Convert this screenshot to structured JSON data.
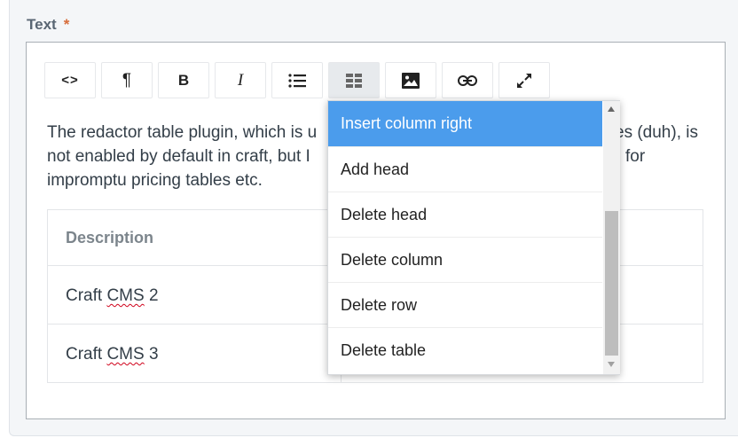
{
  "field": {
    "label": "Text",
    "required_marker": "*"
  },
  "toolbar": {
    "buttons": [
      {
        "name": "html-button",
        "icon": "code-icon",
        "glyph": "<>"
      },
      {
        "name": "format-button",
        "icon": "paragraph-icon",
        "glyph": "¶"
      },
      {
        "name": "bold-button",
        "icon": "bold-icon",
        "glyph": "B"
      },
      {
        "name": "italic-button",
        "icon": "italic-icon",
        "glyph": "I"
      },
      {
        "name": "lists-button",
        "icon": "list-icon"
      },
      {
        "name": "table-button",
        "icon": "table-icon",
        "active": true
      },
      {
        "name": "image-button",
        "icon": "image-icon"
      },
      {
        "name": "link-button",
        "icon": "link-icon"
      },
      {
        "name": "fullscreen-button",
        "icon": "expand-icon"
      }
    ]
  },
  "content": {
    "line1_left": "The redactor table plugin, which is u",
    "line1_right": "es (duh), is",
    "line2_left": "not enabled by default in craft, but I",
    "line2_right": "for",
    "line3": "impromptu pricing tables etc."
  },
  "table": {
    "header": "Description",
    "rows": [
      {
        "prefix": "Craft ",
        "misspelled": "CMS",
        "suffix": " 2"
      },
      {
        "prefix": "Craft ",
        "misspelled": "CMS",
        "suffix": " 3"
      }
    ]
  },
  "dropdown": {
    "items": [
      {
        "label": "Insert column right",
        "highlighted": true
      },
      {
        "label": "Add head"
      },
      {
        "label": "Delete head"
      },
      {
        "label": "Delete column"
      },
      {
        "label": "Delete row"
      },
      {
        "label": "Delete table"
      }
    ]
  },
  "colors": {
    "highlight": "#4b9cec",
    "required": "#d76c3a",
    "label": "#596673",
    "text": "#333e48"
  }
}
